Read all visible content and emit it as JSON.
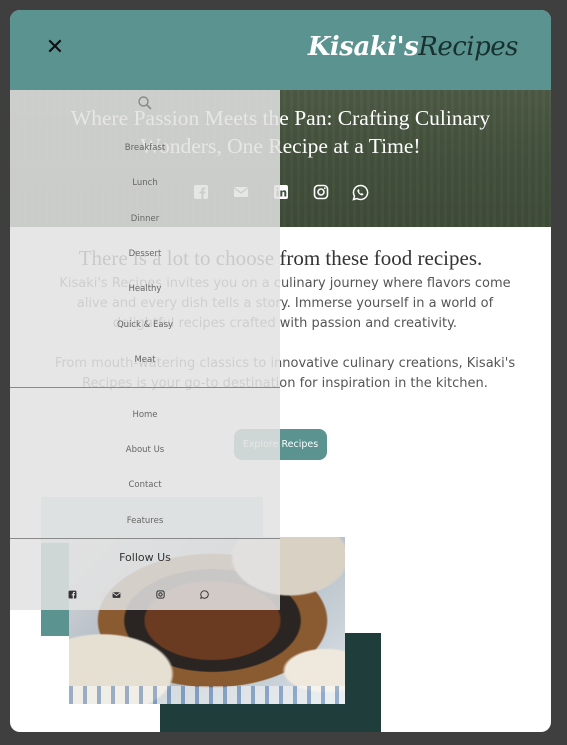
{
  "header": {
    "logo_part1": "Kisaki's",
    "logo_part2": "Recipes",
    "close_symbol": "✕"
  },
  "hero": {
    "title": "Where Passion Meets the Pan: Crafting Culinary Wonders, One Recipe at a Time!",
    "social_icons": [
      "facebook-icon",
      "email-icon",
      "linkedin-icon",
      "instagram-icon",
      "whatsapp-icon"
    ]
  },
  "intro": {
    "title": "There is a lot to choose from these food recipes.",
    "paragraph1": "Kisaki's Recipes invites you on a culinary journey where flavors come alive and every dish tells a story. Immerse yourself in a world of delightful recipes crafted with passion and creativity.",
    "paragraph2": "From mouth-watering classics to innovative culinary creations, Kisaki's Recipes is your go-to destination for inspiration in the kitchen.",
    "button_label": "Explore Recipes"
  },
  "sidebar": {
    "categories": [
      "Breakfast",
      "Lunch",
      "Dinner",
      "Dessert",
      "Healthy",
      "Quick & Easy",
      "Meat"
    ],
    "nav": [
      "Home",
      "About Us",
      "Contact",
      "Features"
    ],
    "follow_label": "Follow Us",
    "social_icons": [
      "facebook-icon",
      "email-icon",
      "instagram-icon",
      "whatsapp-icon"
    ]
  },
  "colors": {
    "brand_teal": "#5a9390",
    "dark_teal": "#1e3d3b",
    "light_teal": "#c6dada"
  }
}
